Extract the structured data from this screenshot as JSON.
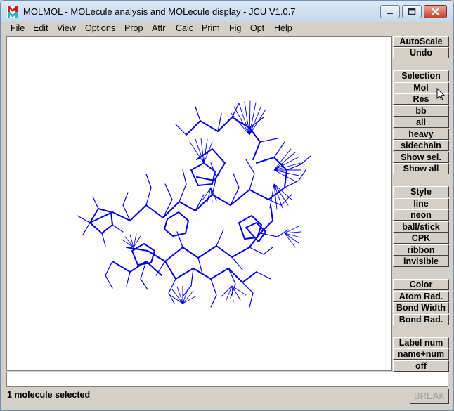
{
  "window": {
    "title": "MOLMOL - MOLecule analysis and MOLecule display - JCU V1.0.7"
  },
  "menu": [
    "File",
    "Edit",
    "View",
    "Options",
    "Prop",
    "Attr",
    "Calc",
    "Prim",
    "Fig",
    "Opt",
    "Help"
  ],
  "side_buttons": {
    "autoscale": "AutoScale",
    "undo": "Undo",
    "selection": "Selection",
    "mol": "Mol",
    "res": "Res",
    "bb": "bb",
    "all": "all",
    "heavy": "heavy",
    "sidechain": "sidechain",
    "show_sel": "Show sel.",
    "show_all": "Show all",
    "style": "Style",
    "line": "line",
    "neon": "neon",
    "ball_stick": "ball/stick",
    "cpk": "CPK",
    "ribbon": "ribbon",
    "invisible": "invisible",
    "color": "Color",
    "atom_rad": "Atom Rad.",
    "bond_width": "Bond Width",
    "bond_rad": "Bond Rad.",
    "label_num": "Label num",
    "name_num": "name+num",
    "off": "off"
  },
  "command_input": "",
  "status": "1 molecule selected",
  "break_label": "BREAK",
  "colors": {
    "molecule": "#0000ee",
    "canvas": "#ffffff",
    "panel": "#d4d0c8"
  },
  "icons": {
    "app": "molmol-app-icon",
    "minimize": "minimize-icon",
    "maximize": "maximize-icon",
    "close": "close-icon",
    "cursor": "mouse-cursor-icon"
  }
}
